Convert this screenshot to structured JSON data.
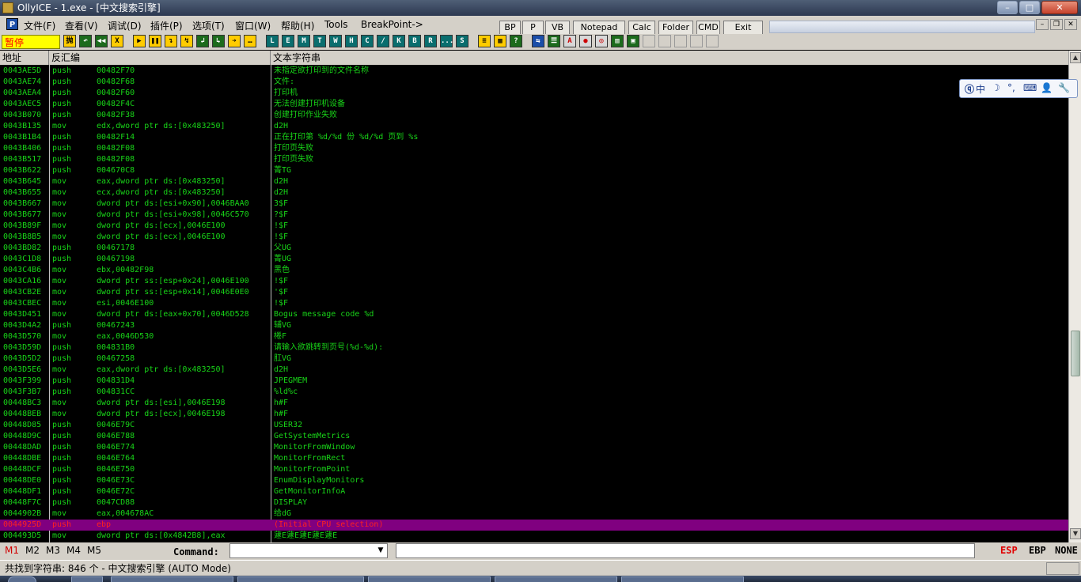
{
  "window": {
    "title": "OllyICE - 1.exe - [中文搜索引擎]",
    "controls": {
      "minimize": "–",
      "maximize": "□",
      "close": "✕"
    }
  },
  "menu": {
    "items": [
      "文件(F)",
      "查看(V)",
      "调试(D)",
      "插件(P)",
      "选项(T)",
      "窗口(W)",
      "帮助(H)",
      "Tools",
      "BreakPoint->"
    ],
    "buttons": [
      "BP",
      "P",
      "VB",
      "Notepad",
      "Calc",
      "Folder",
      "CMD",
      "Exit"
    ],
    "mdi_icon": "P",
    "mdi_controls": {
      "minimize": "–",
      "restore": "❐",
      "close": "✕"
    }
  },
  "toolbar": {
    "status": "暂停",
    "tools": [
      {
        "g": "抛",
        "c": "y"
      },
      {
        "g": "↶",
        "c": "g"
      },
      {
        "g": "◀◀",
        "c": "g"
      },
      {
        "g": "X",
        "c": "y"
      },
      {
        "g": "▶",
        "c": "y"
      },
      {
        "g": "❚❚",
        "c": "y"
      },
      {
        "g": "↴",
        "c": "y"
      },
      {
        "g": "↯",
        "c": "y"
      },
      {
        "g": "↲",
        "c": "g"
      },
      {
        "g": "↳",
        "c": "g"
      },
      {
        "g": "➔",
        "c": "y"
      },
      {
        "g": "…",
        "c": "y"
      },
      {
        "g": "L",
        "c": "c"
      },
      {
        "g": "E",
        "c": "c"
      },
      {
        "g": "M",
        "c": "c"
      },
      {
        "g": "T",
        "c": "c"
      },
      {
        "g": "W",
        "c": "c"
      },
      {
        "g": "H",
        "c": "c"
      },
      {
        "g": "C",
        "c": "c"
      },
      {
        "g": "/",
        "c": "c"
      },
      {
        "g": "K",
        "c": "c"
      },
      {
        "g": "B",
        "c": "c"
      },
      {
        "g": "R",
        "c": "c"
      },
      {
        "g": "...",
        "c": "c"
      },
      {
        "g": "S",
        "c": "c"
      },
      {
        "g": "≡",
        "c": "y"
      },
      {
        "g": "▦",
        "c": "y"
      },
      {
        "g": "?",
        "c": "g"
      },
      {
        "g": "⇆",
        "c": "b"
      },
      {
        "g": "☰",
        "c": "g"
      },
      {
        "g": "A",
        "c": "r"
      },
      {
        "g": "●",
        "c": "r"
      },
      {
        "g": "◎",
        "c": "r"
      },
      {
        "g": "▥",
        "c": "g"
      },
      {
        "g": "▣",
        "c": "g"
      },
      {
        "g": "",
        "c": "e"
      },
      {
        "g": "",
        "c": "e"
      },
      {
        "g": "",
        "c": "e"
      },
      {
        "g": "",
        "c": "e"
      },
      {
        "g": "",
        "c": "e"
      }
    ]
  },
  "columns": [
    "地址",
    "反汇编",
    "文本字符串"
  ],
  "rows": [
    [
      "0043AE5D",
      "push",
      "00482F70",
      "未指定欲打印到的文件名称"
    ],
    [
      "0043AE74",
      "push",
      "00482F68",
      "文件:"
    ],
    [
      "0043AEA4",
      "push",
      "00482F60",
      "打印机"
    ],
    [
      "0043AEC5",
      "push",
      "00482F4C",
      "无法创建打印机设备"
    ],
    [
      "0043B070",
      "push",
      "00482F38",
      "创建打印作业失败"
    ],
    [
      "0043B135",
      "mov",
      "edx,dword ptr ds:[0x483250]",
      "d2H"
    ],
    [
      "0043B1B4",
      "push",
      "00482F14",
      "正在打印第 %d/%d 份 %d/%d 页到 %s"
    ],
    [
      "0043B406",
      "push",
      "00482F08",
      "打印页失败"
    ],
    [
      "0043B517",
      "push",
      "00482F08",
      "打印页失败"
    ],
    [
      "0043B622",
      "push",
      "004670C8",
      "菁TG"
    ],
    [
      "0043B645",
      "mov",
      "eax,dword ptr ds:[0x483250]",
      "d2H"
    ],
    [
      "0043B655",
      "mov",
      "ecx,dword ptr ds:[0x483250]",
      "d2H"
    ],
    [
      "0043B667",
      "mov",
      "dword ptr ds:[esi+0x90],0046BAA0",
      "3$F"
    ],
    [
      "0043B677",
      "mov",
      "dword ptr ds:[esi+0x98],0046C570",
      "?$F"
    ],
    [
      "0043B89F",
      "mov",
      "dword ptr ds:[ecx],0046E100",
      "!$F"
    ],
    [
      "0043B8B5",
      "mov",
      "dword ptr ds:[ecx],0046E100",
      "!$F"
    ],
    [
      "0043BD82",
      "push",
      "00467178",
      "父UG"
    ],
    [
      "0043C1D8",
      "push",
      "00467198",
      "菁UG"
    ],
    [
      "0043C4B6",
      "mov",
      "ebx,00482F98",
      "黑色"
    ],
    [
      "0043CA16",
      "mov",
      "dword ptr ss:[esp+0x24],0046E100",
      "!$F"
    ],
    [
      "0043CB2E",
      "mov",
      "dword ptr ss:[esp+0x14],0046E0E0",
      "'$F"
    ],
    [
      "0043CBEC",
      "mov",
      "esi,0046E100",
      "!$F"
    ],
    [
      "0043D451",
      "mov",
      "dword ptr ds:[eax+0x70],0046D528",
      "Bogus message code %d"
    ],
    [
      "0043D4A2",
      "push",
      "00467243",
      "辅VG"
    ],
    [
      "0043D570",
      "mov",
      "eax,0046D530",
      "棬F"
    ],
    [
      "0043D59D",
      "push",
      "004831B0",
      "请输入欲跳转到页号(%d-%d):"
    ],
    [
      "0043D5D2",
      "push",
      "00467258",
      "肛VG"
    ],
    [
      "0043D5E6",
      "mov",
      "eax,dword ptr ds:[0x483250]",
      "d2H"
    ],
    [
      "0043F399",
      "push",
      "004831D4",
      "JPEGMEM"
    ],
    [
      "0043F3B7",
      "push",
      "004831CC",
      "%ld%c"
    ],
    [
      "00448BC3",
      "mov",
      "dword ptr ds:[esi],0046E198",
      "h#F"
    ],
    [
      "00448BEB",
      "mov",
      "dword ptr ds:[ecx],0046E198",
      "h#F"
    ],
    [
      "00448D85",
      "push",
      "0046E79C",
      "USER32"
    ],
    [
      "00448D9C",
      "push",
      "0046E788",
      "GetSystemMetrics"
    ],
    [
      "00448DAD",
      "push",
      "0046E774",
      "MonitorFromWindow"
    ],
    [
      "00448DBE",
      "push",
      "0046E764",
      "MonitorFromRect"
    ],
    [
      "00448DCF",
      "push",
      "0046E750",
      "MonitorFromPoint"
    ],
    [
      "00448DE0",
      "push",
      "0046E73C",
      "EnumDisplayMonitors"
    ],
    [
      "00448DF1",
      "push",
      "0046E72C",
      "GetMonitorInfoA"
    ],
    [
      "00448F7C",
      "push",
      "0047CD88",
      "DISPLAY"
    ],
    [
      "0044902B",
      "mov",
      "eax,004678AC",
      "给dG"
    ],
    [
      "0044925D",
      "push",
      "ebp",
      "(Initial CPU selection)"
    ],
    [
      "004493D5",
      "mov",
      "dword ptr ds:[0x4842B8],eax",
      "蘧E蘧E蘧E蘧E蘧E"
    ]
  ],
  "selected_row": 41,
  "ime": {
    "items": [
      "中",
      "☽",
      "°,",
      "⌨",
      "👤",
      "🔧"
    ]
  },
  "command": {
    "tabs": [
      "M1",
      "M2",
      "M3",
      "M4",
      "M5"
    ],
    "label": "Command:",
    "value": "",
    "registers": [
      "ESP",
      "EBP",
      "NONE"
    ]
  },
  "status": {
    "text": "共找到字符串: 846 个  -  中文搜索引擎 (AUTO Mode)"
  },
  "colors": {
    "text": "#18d418",
    "selected_bg": "#800080",
    "selected_fg": "#ff2020",
    "pause_bg": "#ffff00",
    "pause_fg": "#ff0000"
  }
}
